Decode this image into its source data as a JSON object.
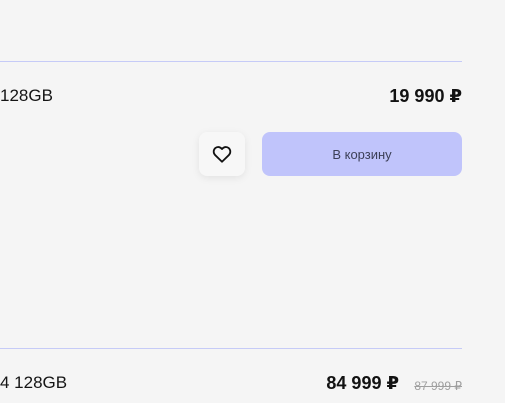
{
  "products": [
    {
      "name": "128GB",
      "price": "19 990 ₽",
      "favorite_icon": "heart-outline-icon",
      "cart_label": "В корзину"
    },
    {
      "name": "4 128GB",
      "price": "84 999 ₽",
      "old_price": "87 999 ₽"
    }
  ],
  "colors": {
    "background": "#f5f5f5",
    "divider": "#c6cbf7",
    "cart_button_bg": "#c0c4fb",
    "cart_button_text": "#3c3f57"
  }
}
